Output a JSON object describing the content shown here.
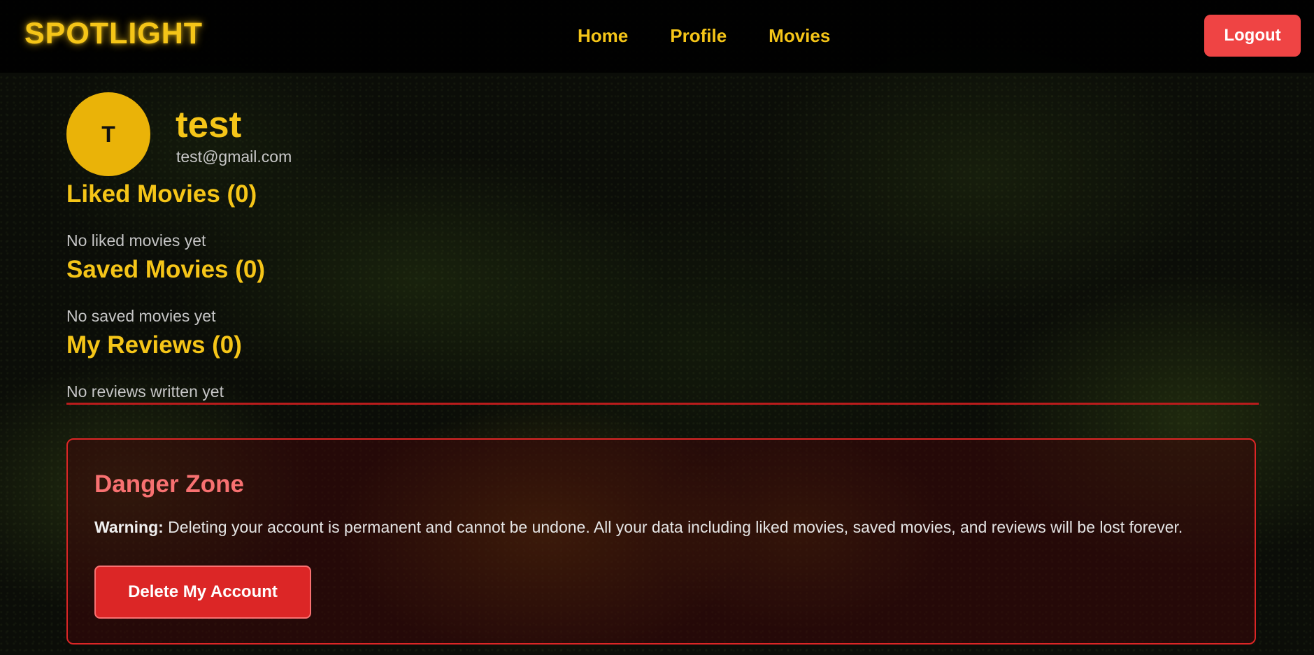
{
  "nav": {
    "logo": "SPOTLIGHT",
    "links": [
      {
        "label": "Home"
      },
      {
        "label": "Profile"
      },
      {
        "label": "Movies"
      }
    ],
    "logout_label": "Logout"
  },
  "profile": {
    "avatar_initial": "T",
    "username": "test",
    "email": "test@gmail.com"
  },
  "sections": {
    "liked": {
      "title": "Liked Movies (0)",
      "empty": "No liked movies yet"
    },
    "saved": {
      "title": "Saved Movies (0)",
      "empty": "No saved movies yet"
    },
    "reviews": {
      "title": "My Reviews (0)",
      "empty": "No reviews written yet"
    }
  },
  "danger_zone": {
    "title": "Danger Zone",
    "warning_label": "Warning:",
    "warning_text": " Deleting your account is permanent and cannot be undone. All your data including liked movies, saved movies, and reviews will be lost forever.",
    "delete_label": "Delete My Account"
  },
  "colors": {
    "accent": "#f5c518",
    "danger": "#dc2626",
    "logout": "#ef4444"
  }
}
